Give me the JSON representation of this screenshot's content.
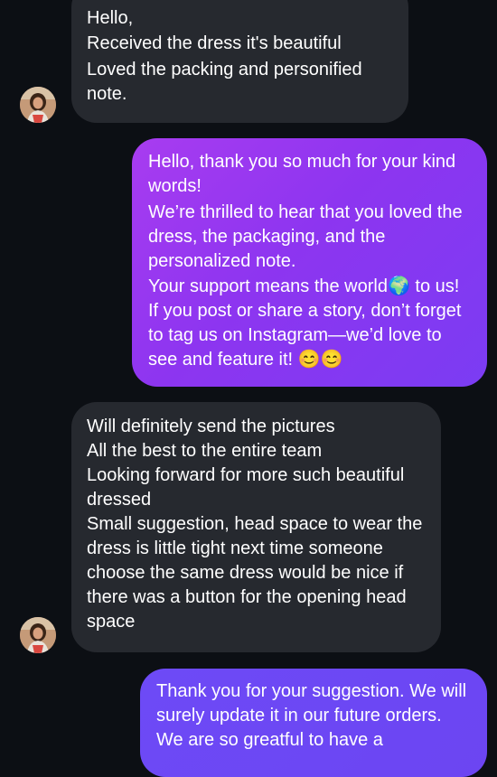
{
  "messages": [
    {
      "lines": [
        "Hello,",
        "Received the dress it's beautiful",
        "Loved the packing and personified note."
      ]
    },
    {
      "lines": [
        "Hello, thank you so much for your kind words!",
        "We’re thrilled to hear that you loved the dress, the packaging, and the personalized note.",
        "Your support means the world🌍 to us! If you post or share a story, don’t forget to tag us on Instagram—we’d love to see and feature it! 😊😊"
      ]
    },
    {
      "lines": [
        "Will definitely send the pictures",
        "All the best to the entire team",
        "Looking forward for more such beautiful dressed",
        "Small suggestion, head space to wear the dress is little tight next time someone choose the same dress would be nice if there was a button for the opening head space"
      ]
    },
    {
      "lines": [
        "Thank you for your suggestion. We will surely update it in our future orders. We are so greatful to have a"
      ]
    }
  ],
  "colors": {
    "background": "#0c0f14",
    "incoming_bubble": "#26292f",
    "outgoing_gradient_start": "#a83cf0",
    "outgoing_gradient_end": "#6d4af6"
  }
}
